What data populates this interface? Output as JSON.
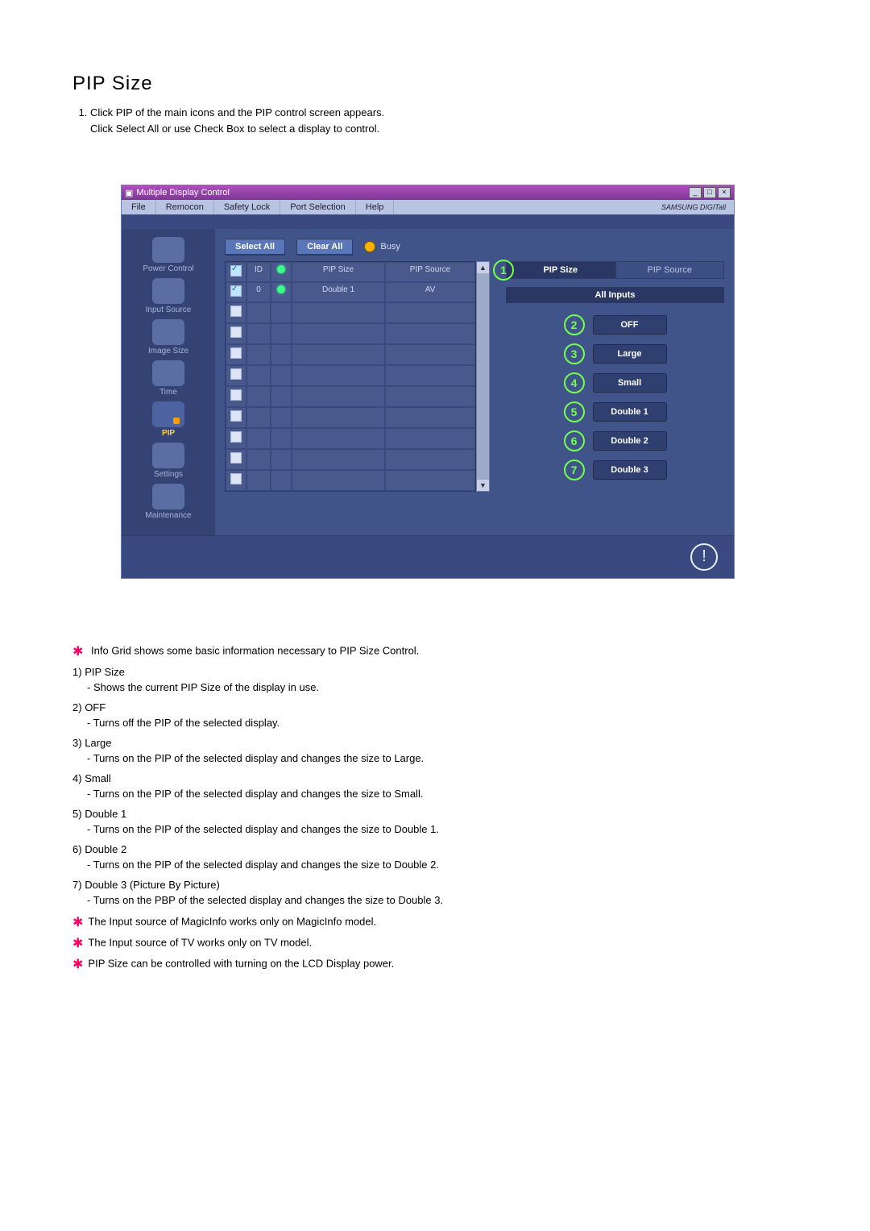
{
  "title": "PIP Size",
  "intro": {
    "line1": "Click PIP of the main icons and the PIP control screen appears.",
    "line2": "Click Select All or use Check Box to select a display to control."
  },
  "window": {
    "caption": "Multiple Display Control",
    "menu": [
      "File",
      "Remocon",
      "Safety Lock",
      "Port Selection",
      "Help"
    ],
    "brand": "SAMSUNG DIGITall",
    "win_controls": {
      "min": "_",
      "max": "□",
      "close": "×"
    },
    "sidebar": [
      {
        "label": "Power Control"
      },
      {
        "label": "Input Source"
      },
      {
        "label": "Image Size"
      },
      {
        "label": "Time"
      },
      {
        "label": "PIP",
        "active": true
      },
      {
        "label": "Settings"
      },
      {
        "label": "Maintenance"
      }
    ],
    "buttons": {
      "select_all": "Select All",
      "clear_all": "Clear All",
      "busy": "Busy"
    },
    "grid": {
      "headers": {
        "cb": "☑",
        "id": "ID",
        "status": "◉",
        "size": "PIP Size",
        "source": "PIP Source"
      },
      "row": {
        "id": "0",
        "size": "Double 1",
        "source": "AV"
      }
    },
    "tabs": {
      "size": "PIP Size",
      "source": "PIP Source"
    },
    "all_inputs": "All Inputs",
    "options": [
      {
        "num": "2",
        "label": "OFF"
      },
      {
        "num": "3",
        "label": "Large"
      },
      {
        "num": "4",
        "label": "Small"
      },
      {
        "num": "5",
        "label": "Double 1"
      },
      {
        "num": "6",
        "label": "Double 2"
      },
      {
        "num": "7",
        "label": "Double 3"
      }
    ],
    "pip_size_callout": "1"
  },
  "info_line": "Info Grid shows some basic information necessary to PIP Size Control.",
  "desc": [
    {
      "num": "1)",
      "name": "PIP Size",
      "sub": "- Shows the current PIP Size of the display in use."
    },
    {
      "num": "2)",
      "name": "OFF",
      "sub": "- Turns off the PIP of the selected display."
    },
    {
      "num": "3)",
      "name": "Large",
      "sub": "- Turns on the PIP of the selected display and changes the size to Large."
    },
    {
      "num": "4)",
      "name": "Small",
      "sub": "- Turns on the PIP of the selected display and changes the size to Small."
    },
    {
      "num": "5)",
      "name": "Double 1",
      "sub": "- Turns on the PIP of the selected display and changes the size to Double 1."
    },
    {
      "num": "6)",
      "name": "Double 2",
      "sub": "- Turns on the PIP of the selected display and changes the size to Double 2."
    },
    {
      "num": "7)",
      "name": "Double 3 (Picture By Picture)",
      "sub": "- Turns on the PBP of the selected display and changes the size to Double 3."
    }
  ],
  "notes": [
    "The Input source of MagicInfo works only on MagicInfo model.",
    "The Input source of TV works only on TV model.",
    "PIP Size can be controlled with turning on the LCD Display power."
  ]
}
